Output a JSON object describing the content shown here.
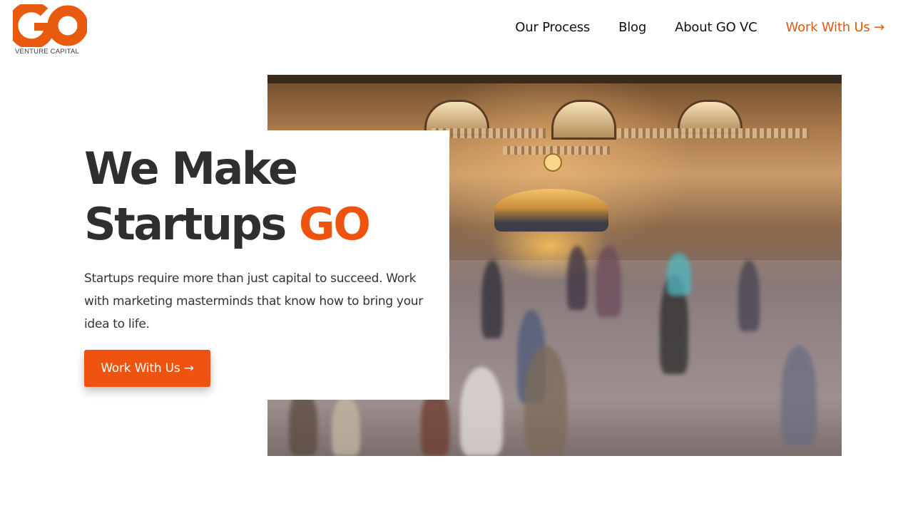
{
  "header": {
    "logo": {
      "mark": "GO",
      "subtitle": "VENTURE CAPITAL",
      "icon": "go-vc-logo"
    },
    "nav": [
      {
        "label": "Our Process"
      },
      {
        "label": "Blog"
      },
      {
        "label": "About GO VC"
      },
      {
        "label": "Work With Us →"
      }
    ]
  },
  "hero": {
    "title_line1": "We Make",
    "title_line2_prefix": "Startups ",
    "title_line2_accent": "GO",
    "description": "Startups require more than just capital to succeed. Work with marketing masterminds that know how to bring your idea to life.",
    "button_label": "Work With Us →",
    "image": "grand-central-terminal-photo"
  },
  "colors": {
    "accent": "#ee5410",
    "nav_accent": "#e5570d",
    "text_dark": "#2f2f2f",
    "background": "#ffffff"
  }
}
